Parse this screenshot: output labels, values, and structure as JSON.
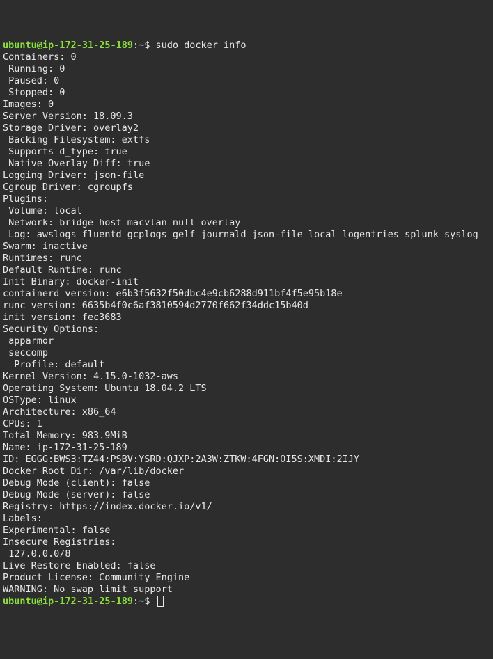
{
  "prompt1": {
    "user": "ubuntu",
    "at": "@",
    "host": "ip-172-31-25-189",
    "colon": ":",
    "path": "~",
    "dollar": "$ ",
    "command": "sudo docker info"
  },
  "output": [
    "Containers: 0",
    " Running: 0",
    " Paused: 0",
    " Stopped: 0",
    "Images: 0",
    "Server Version: 18.09.3",
    "Storage Driver: overlay2",
    " Backing Filesystem: extfs",
    " Supports d_type: true",
    " Native Overlay Diff: true",
    "Logging Driver: json-file",
    "Cgroup Driver: cgroupfs",
    "Plugins:",
    " Volume: local",
    " Network: bridge host macvlan null overlay",
    " Log: awslogs fluentd gcplogs gelf journald json-file local logentries splunk syslog",
    "Swarm: inactive",
    "Runtimes: runc",
    "Default Runtime: runc",
    "Init Binary: docker-init",
    "containerd version: e6b3f5632f50dbc4e9cb6288d911bf4f5e95b18e",
    "runc version: 6635b4f0c6af3810594d2770f662f34ddc15b40d",
    "init version: fec3683",
    "Security Options:",
    " apparmor",
    " seccomp",
    "  Profile: default",
    "Kernel Version: 4.15.0-1032-aws",
    "Operating System: Ubuntu 18.04.2 LTS",
    "OSType: linux",
    "Architecture: x86_64",
    "CPUs: 1",
    "Total Memory: 983.9MiB",
    "Name: ip-172-31-25-189",
    "ID: EGGG:BWS3:TZ44:PSBV:YSRD:QJXP:2A3W:ZTKW:4FGN:OI5S:XMDI:2IJY",
    "Docker Root Dir: /var/lib/docker",
    "Debug Mode (client): false",
    "Debug Mode (server): false",
    "Registry: https://index.docker.io/v1/",
    "Labels:",
    "Experimental: false",
    "Insecure Registries:",
    " 127.0.0.0/8",
    "Live Restore Enabled: false",
    "Product License: Community Engine",
    "",
    "WARNING: No swap limit support"
  ],
  "prompt2": {
    "user": "ubuntu",
    "at": "@",
    "host": "ip-172-31-25-189",
    "colon": ":",
    "path": "~",
    "dollar": "$ "
  }
}
